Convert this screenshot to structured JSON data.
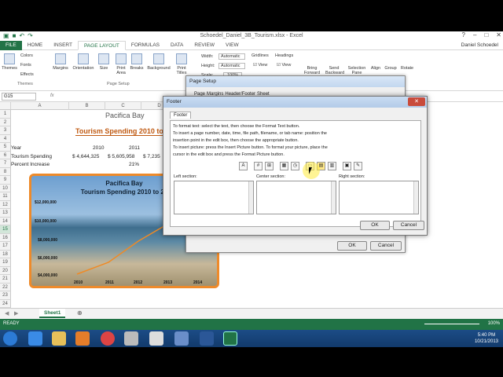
{
  "window": {
    "title": "Schoedel_Daniel_3B_Tourism.xlsx - Excel",
    "user": "Daniel Schoedel",
    "controls": [
      "?",
      "–",
      "□",
      "✕"
    ]
  },
  "ribbon_tabs": [
    "FILE",
    "HOME",
    "INSERT",
    "PAGE LAYOUT",
    "FORMULAS",
    "DATA",
    "REVIEW",
    "VIEW"
  ],
  "ribbon": {
    "themes_group": {
      "themes": "Themes",
      "colors": "Colors",
      "fonts": "Fonts",
      "effects": "Effects",
      "label": "Themes"
    },
    "page_setup_group": {
      "items": [
        "Margins",
        "Orientation",
        "Size",
        "Print Area",
        "Breaks",
        "Background",
        "Print Titles"
      ],
      "label": "Page Setup"
    },
    "scale": {
      "width_label": "Width:",
      "width_value": "Automatic",
      "height_label": "Height:",
      "height_value": "Automatic",
      "scale_label": "Scale:",
      "scale_value": "100%"
    },
    "sheet_options": {
      "gridlines": "Gridlines",
      "headings": "Headings",
      "view": "View",
      "print": "Print"
    },
    "arrange": {
      "items": [
        "Bring Forward",
        "Send Backward",
        "Selection Pane",
        "Align",
        "Group",
        "Rotate"
      ]
    }
  },
  "formula_bar": {
    "name_box": "G15",
    "fx": "fx"
  },
  "columns": [
    "A",
    "B",
    "C",
    "D"
  ],
  "rows": [
    "1",
    "2",
    "3",
    "4",
    "5",
    "6",
    "7",
    "8",
    "9",
    "10",
    "11",
    "12",
    "13",
    "14",
    "15",
    "16",
    "17",
    "18",
    "19",
    "20",
    "21",
    "22",
    "23",
    "24",
    "25"
  ],
  "selected_row": "15",
  "cells": {
    "title": "Pacifica Bay",
    "subtitle": "Tourism Spending 2010 to",
    "r4": {
      "a": "Year",
      "b": "2010",
      "c": "2011"
    },
    "r5": {
      "a": "Tourism Spending",
      "b": "$ 4,644,325",
      "c": "$ 5,605,958",
      "d": "$ 7,235"
    },
    "r6": {
      "a": "Percent Increase",
      "c": "21%"
    }
  },
  "picture_chart": {
    "title1": "Pacifica Bay",
    "title2": "Tourism Spending 2010 to 20",
    "y_ticks": [
      "$12,000,000",
      "$10,000,000",
      "$8,000,000",
      "$6,000,000",
      "$4,000,000"
    ],
    "x_ticks": [
      "2010",
      "2011",
      "2012",
      "2013",
      "2014"
    ]
  },
  "page_setup_dialog": {
    "title": "Page Setup",
    "tabs": [
      "Page",
      "Margins",
      "Header/Footer",
      "Sheet"
    ],
    "ok": "OK",
    "cancel": "Cancel"
  },
  "footer_dialog": {
    "title": "Footer",
    "tab": "Footer",
    "instructions": [
      "To format text:  select the text, then choose the Format Text button.",
      "To insert a page number, date, time, file path, filename, or tab name:  position the",
      "      insertion point in the edit box, then choose the appropriate button.",
      "To insert picture: press the Insert Picture button.  To format your picture, place the",
      "      cursor in the edit box and press the Format Picture button."
    ],
    "left_section": "Left section:",
    "center_section": "Center section:",
    "right_section": "Right section:",
    "ok": "OK",
    "cancel": "Cancel"
  },
  "sheet_tab": "Sheet1",
  "status": {
    "ready": "READY",
    "zoom": "100%"
  },
  "clock": {
    "time": "5:40 PM",
    "date": "10/21/2013"
  }
}
